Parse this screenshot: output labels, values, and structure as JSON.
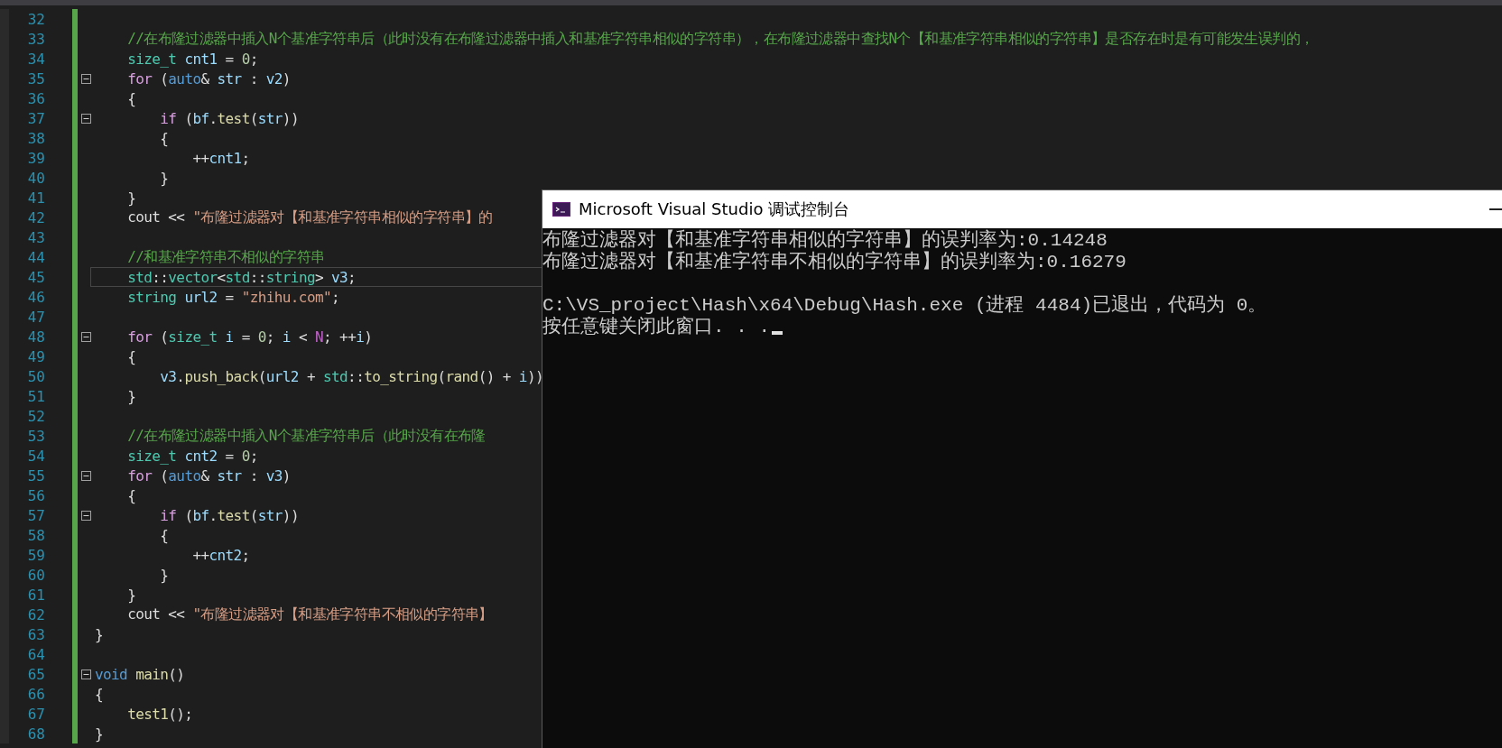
{
  "editor": {
    "lines": [
      {
        "number": "32",
        "current": false
      },
      {
        "number": "33",
        "current": false,
        "tokens": [
          {
            "kind": "comment",
            "text": "    //在布隆过滤器中插入N个基准字符串后（此时没有在布隆过滤器中插入和基准字符串相似的字符串），在布隆过滤器中查找N个【和基准字符串相似的字符串】是否存在时是有可能发生误判的，"
          }
        ]
      },
      {
        "number": "34",
        "current": false,
        "tokens": [
          {
            "kind": "type",
            "text": "    size_t"
          },
          {
            "kind": "variable",
            "text": " cnt1"
          },
          {
            "kind": "plain",
            "text": " = "
          },
          {
            "kind": "number",
            "text": "0"
          },
          {
            "kind": "plain",
            "text": ";"
          }
        ]
      },
      {
        "number": "35",
        "current": false,
        "fold": {
          "expanded": true
        },
        "tokens": [
          {
            "kind": "control",
            "text": "    for"
          },
          {
            "kind": "plain",
            "text": " ("
          },
          {
            "kind": "keyword",
            "text": "auto"
          },
          {
            "kind": "plain",
            "text": "& "
          },
          {
            "kind": "variable",
            "text": "str"
          },
          {
            "kind": "plain",
            "text": " : "
          },
          {
            "kind": "variable",
            "text": "v2"
          },
          {
            "kind": "plain",
            "text": ")"
          }
        ]
      },
      {
        "number": "36",
        "current": false,
        "tokens": [
          {
            "kind": "plain",
            "text": "    {"
          }
        ]
      },
      {
        "number": "37",
        "current": false,
        "fold": {
          "expanded": true
        },
        "tokens": [
          {
            "kind": "control",
            "text": "        if"
          },
          {
            "kind": "plain",
            "text": " ("
          },
          {
            "kind": "variable",
            "text": "bf"
          },
          {
            "kind": "plain",
            "text": "."
          },
          {
            "kind": "function",
            "text": "test"
          },
          {
            "kind": "plain",
            "text": "("
          },
          {
            "kind": "variable",
            "text": "str"
          },
          {
            "kind": "plain",
            "text": "))"
          }
        ]
      },
      {
        "number": "38",
        "current": false,
        "tokens": [
          {
            "kind": "plain",
            "text": "        {"
          }
        ]
      },
      {
        "number": "39",
        "current": false,
        "tokens": [
          {
            "kind": "plain",
            "text": "            ++"
          },
          {
            "kind": "variable",
            "text": "cnt1"
          },
          {
            "kind": "plain",
            "text": ";"
          }
        ]
      },
      {
        "number": "40",
        "current": false,
        "tokens": [
          {
            "kind": "plain",
            "text": "        }"
          }
        ]
      },
      {
        "number": "41",
        "current": false,
        "tokens": [
          {
            "kind": "plain",
            "text": "    }"
          }
        ]
      },
      {
        "number": "42",
        "current": false,
        "tokens": [
          {
            "kind": "plain",
            "text": "    cout << "
          },
          {
            "kind": "string",
            "text": "\"布隆过滤器对【和基准字符串相似的字符串】的"
          }
        ]
      },
      {
        "number": "43",
        "current": false
      },
      {
        "number": "44",
        "current": false,
        "tokens": [
          {
            "kind": "comment",
            "text": "    //和基准字符串不相似的字符串"
          }
        ]
      },
      {
        "number": "45",
        "current": true,
        "tokens": [
          {
            "kind": "type",
            "text": "    std"
          },
          {
            "kind": "plain",
            "text": "::"
          },
          {
            "kind": "type",
            "text": "vector"
          },
          {
            "kind": "plain",
            "text": "<"
          },
          {
            "kind": "type",
            "text": "std"
          },
          {
            "kind": "plain",
            "text": "::"
          },
          {
            "kind": "type",
            "text": "string"
          },
          {
            "kind": "plain",
            "text": "> "
          },
          {
            "kind": "variable",
            "text": "v3"
          },
          {
            "kind": "plain",
            "text": ";"
          }
        ]
      },
      {
        "number": "46",
        "current": false,
        "tokens": [
          {
            "kind": "type",
            "text": "    string"
          },
          {
            "kind": "variable",
            "text": " url2"
          },
          {
            "kind": "plain",
            "text": " = "
          },
          {
            "kind": "string",
            "text": "\"zhihu.com\""
          },
          {
            "kind": "plain",
            "text": ";"
          }
        ]
      },
      {
        "number": "47",
        "current": false
      },
      {
        "number": "48",
        "current": false,
        "fold": {
          "expanded": true
        },
        "tokens": [
          {
            "kind": "control",
            "text": "    for"
          },
          {
            "kind": "plain",
            "text": " ("
          },
          {
            "kind": "type",
            "text": "size_t"
          },
          {
            "kind": "variable",
            "text": " i"
          },
          {
            "kind": "plain",
            "text": " = "
          },
          {
            "kind": "number",
            "text": "0"
          },
          {
            "kind": "plain",
            "text": "; "
          },
          {
            "kind": "variable",
            "text": "i"
          },
          {
            "kind": "plain",
            "text": " < "
          },
          {
            "kind": "macro",
            "text": "N"
          },
          {
            "kind": "plain",
            "text": "; ++"
          },
          {
            "kind": "variable",
            "text": "i"
          },
          {
            "kind": "plain",
            "text": ")"
          }
        ]
      },
      {
        "number": "49",
        "current": false,
        "tokens": [
          {
            "kind": "plain",
            "text": "    {"
          }
        ]
      },
      {
        "number": "50",
        "current": false,
        "tokens": [
          {
            "kind": "variable",
            "text": "        v3"
          },
          {
            "kind": "plain",
            "text": "."
          },
          {
            "kind": "function",
            "text": "push_back"
          },
          {
            "kind": "plain",
            "text": "("
          },
          {
            "kind": "variable",
            "text": "url2"
          },
          {
            "kind": "plain",
            "text": " + "
          },
          {
            "kind": "type",
            "text": "std"
          },
          {
            "kind": "plain",
            "text": "::"
          },
          {
            "kind": "function",
            "text": "to_string"
          },
          {
            "kind": "plain",
            "text": "("
          },
          {
            "kind": "function",
            "text": "rand"
          },
          {
            "kind": "plain",
            "text": "() + "
          },
          {
            "kind": "variable",
            "text": "i"
          },
          {
            "kind": "plain",
            "text": "))"
          }
        ]
      },
      {
        "number": "51",
        "current": false,
        "tokens": [
          {
            "kind": "plain",
            "text": "    }"
          }
        ]
      },
      {
        "number": "52",
        "current": false
      },
      {
        "number": "53",
        "current": false,
        "tokens": [
          {
            "kind": "comment",
            "text": "    //在布隆过滤器中插入N个基准字符串后（此时没有在布隆"
          }
        ]
      },
      {
        "number": "54",
        "current": false,
        "tokens": [
          {
            "kind": "type",
            "text": "    size_t"
          },
          {
            "kind": "variable",
            "text": " cnt2"
          },
          {
            "kind": "plain",
            "text": " = "
          },
          {
            "kind": "number",
            "text": "0"
          },
          {
            "kind": "plain",
            "text": ";"
          }
        ]
      },
      {
        "number": "55",
        "current": false,
        "fold": {
          "expanded": true
        },
        "tokens": [
          {
            "kind": "control",
            "text": "    for"
          },
          {
            "kind": "plain",
            "text": " ("
          },
          {
            "kind": "keyword",
            "text": "auto"
          },
          {
            "kind": "plain",
            "text": "& "
          },
          {
            "kind": "variable",
            "text": "str"
          },
          {
            "kind": "plain",
            "text": " : "
          },
          {
            "kind": "variable",
            "text": "v3"
          },
          {
            "kind": "plain",
            "text": ")"
          }
        ]
      },
      {
        "number": "56",
        "current": false,
        "tokens": [
          {
            "kind": "plain",
            "text": "    {"
          }
        ]
      },
      {
        "number": "57",
        "current": false,
        "fold": {
          "expanded": true
        },
        "tokens": [
          {
            "kind": "control",
            "text": "        if"
          },
          {
            "kind": "plain",
            "text": " ("
          },
          {
            "kind": "variable",
            "text": "bf"
          },
          {
            "kind": "plain",
            "text": "."
          },
          {
            "kind": "function",
            "text": "test"
          },
          {
            "kind": "plain",
            "text": "("
          },
          {
            "kind": "variable",
            "text": "str"
          },
          {
            "kind": "plain",
            "text": "))"
          }
        ]
      },
      {
        "number": "58",
        "current": false,
        "tokens": [
          {
            "kind": "plain",
            "text": "        {"
          }
        ]
      },
      {
        "number": "59",
        "current": false,
        "tokens": [
          {
            "kind": "plain",
            "text": "            ++"
          },
          {
            "kind": "variable",
            "text": "cnt2"
          },
          {
            "kind": "plain",
            "text": ";"
          }
        ]
      },
      {
        "number": "60",
        "current": false,
        "tokens": [
          {
            "kind": "plain",
            "text": "        }"
          }
        ]
      },
      {
        "number": "61",
        "current": false,
        "tokens": [
          {
            "kind": "plain",
            "text": "    }"
          }
        ]
      },
      {
        "number": "62",
        "current": false,
        "tokens": [
          {
            "kind": "plain",
            "text": "    cout << "
          },
          {
            "kind": "string",
            "text": "\"布隆过滤器对【和基准字符串不相似的字符串】"
          }
        ]
      },
      {
        "number": "63",
        "current": false,
        "tokens": [
          {
            "kind": "plain",
            "text": "}"
          }
        ]
      },
      {
        "number": "64",
        "current": false
      },
      {
        "number": "65",
        "current": false,
        "fold": {
          "expanded": true
        },
        "tokens": [
          {
            "kind": "keyword",
            "text": "void"
          },
          {
            "kind": "function",
            "text": " main"
          },
          {
            "kind": "plain",
            "text": "()"
          }
        ]
      },
      {
        "number": "66",
        "current": false,
        "tokens": [
          {
            "kind": "plain",
            "text": "{"
          }
        ]
      },
      {
        "number": "67",
        "current": false,
        "tokens": [
          {
            "kind": "function",
            "text": "    test1"
          },
          {
            "kind": "plain",
            "text": "();"
          }
        ]
      },
      {
        "number": "68",
        "current": false,
        "tokens": [
          {
            "kind": "plain",
            "text": "}"
          }
        ]
      }
    ]
  },
  "console": {
    "title": "Microsoft Visual Studio 调试控制台",
    "blocks": [
      [
        "布隆过滤器对【和基准字符串相似的字符串】的误判率为:0.14248",
        "布隆过滤器对【和基准字符串不相似的字符串】的误判率为:0.16279"
      ],
      [
        "C:\\VS_project\\Hash\\x64\\Debug\\Hash.exe (进程 4484)已退出，代码为 0。",
        "按任意键关闭此窗口. . ."
      ]
    ]
  }
}
